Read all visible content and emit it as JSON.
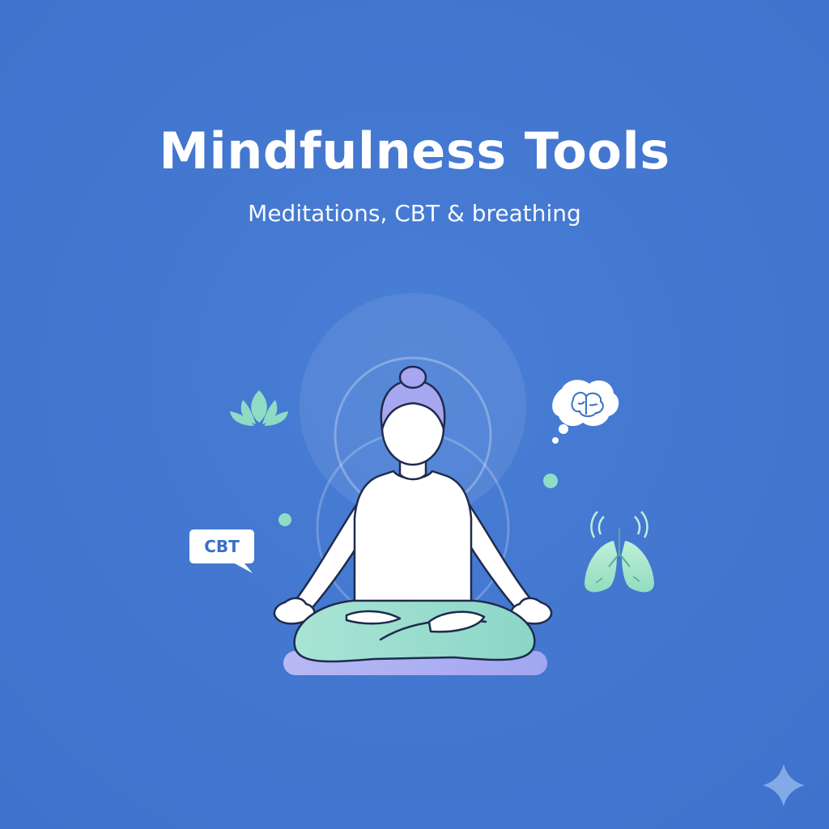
{
  "hero": {
    "title": "Mindfulness Tools",
    "subtitle": "Meditations, CBT & breathing"
  },
  "badges": {
    "cbt_label": "CBT"
  },
  "icons": {
    "lotus": "lotus-icon",
    "brain_bubble": "brain-thought-bubble-icon",
    "lungs": "lungs-icon",
    "sparkle": "sparkle-icon",
    "figure": "meditating-person-illustration"
  },
  "colors": {
    "background": "#4276cf",
    "text": "#ffffff",
    "mint": "#8fdcc4",
    "lavender": "#a3a8f2",
    "outline": "#1f2b4d"
  }
}
